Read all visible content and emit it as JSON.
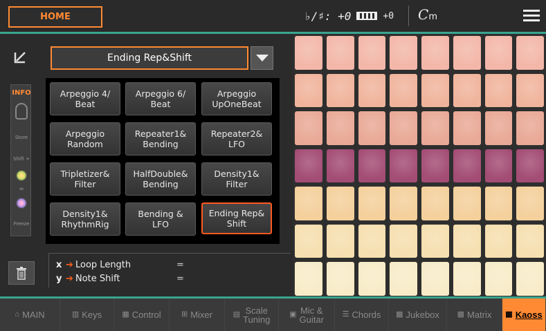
{
  "header": {
    "home_label": "HOME",
    "transpose_text": "♭/♯: +0",
    "keyboard_transpose_text": "+0",
    "chord_root": "C",
    "chord_quality": "m"
  },
  "preset": {
    "selected": "Ending Rep&Shift"
  },
  "side_strip": {
    "info_label": "INFO",
    "store_label": "Store",
    "shift_label": "Shift +",
    "equals_label": "=",
    "freeze_label": "Freeze"
  },
  "presets": [
    {
      "label": "Arpeggio 4/\nBeat",
      "selected": false
    },
    {
      "label": "Arpeggio 6/\nBeat",
      "selected": false
    },
    {
      "label": "Arpeggio\nUpOneBeat",
      "selected": false
    },
    {
      "label": "Arpeggio\nRandom",
      "selected": false
    },
    {
      "label": "Repeater1&\nBending",
      "selected": false
    },
    {
      "label": "Repeater2&\nLFO",
      "selected": false
    },
    {
      "label": "Tripletizer&\nFilter",
      "selected": false
    },
    {
      "label": "HalfDouble&\nBending",
      "selected": false
    },
    {
      "label": "Density1&\nFilter",
      "selected": false
    },
    {
      "label": "Density1&\nRhythmRig",
      "selected": false
    },
    {
      "label": "Bending &\nLFO",
      "selected": false
    },
    {
      "label": "Ending Rep&\nShift",
      "selected": true
    }
  ],
  "xy": {
    "x_axis": "x",
    "x_label": "Loop Length",
    "x_value": "=",
    "y_axis": "y",
    "y_label": "Note Shift",
    "y_value": "="
  },
  "tabs": [
    {
      "label": "MAIN",
      "icon": "home-icon",
      "active": false
    },
    {
      "label": "Keys",
      "icon": "keys-icon",
      "active": false
    },
    {
      "label": "Control",
      "icon": "control-icon",
      "active": false
    },
    {
      "label": "Mixer",
      "icon": "mixer-icon",
      "active": false
    },
    {
      "label": "Scale\nTuning",
      "icon": "scale-icon",
      "active": false
    },
    {
      "label": "Mic &\nGuitar",
      "icon": "mic-icon",
      "active": false
    },
    {
      "label": "Chords",
      "icon": "chords-icon",
      "active": false
    },
    {
      "label": "Jukebox",
      "icon": "jukebox-icon",
      "active": false
    },
    {
      "label": "Matrix",
      "icon": "matrix-icon",
      "active": false
    },
    {
      "label": "Kaoss",
      "icon": "kaoss-icon",
      "active": true
    }
  ],
  "colors": {
    "accent": "#ff8a33",
    "selection": "#ff5a1f",
    "divider": "#3aa58f",
    "pad_rows": [
      "#f3b7a9",
      "#f0b49c",
      "#e9a996",
      "#a34c74",
      "#f4d09c",
      "#f6dfb0",
      "#f8ecc8"
    ]
  }
}
